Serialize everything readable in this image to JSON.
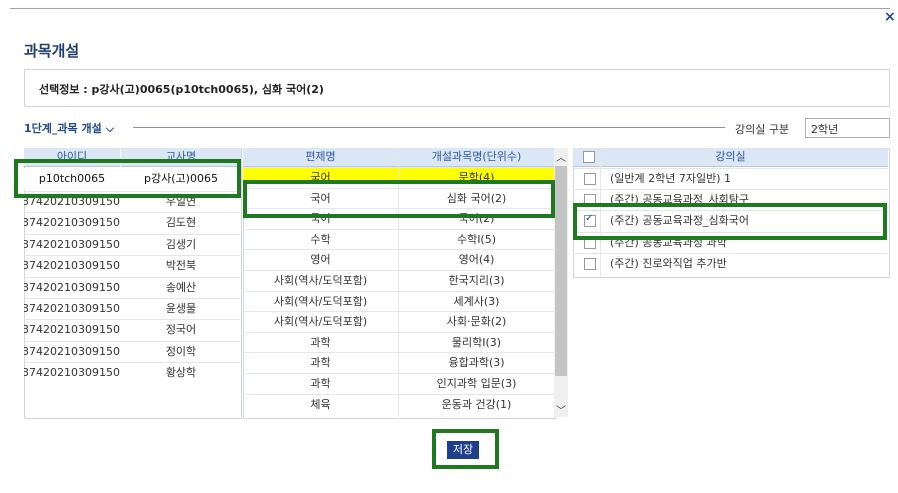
{
  "dialog": {
    "title": "과목개설",
    "close_label": "×",
    "selection_info": "선택정보 : p강사(고)0065(p10tch0065), 심화 국어(2)",
    "step_label": "1단계_과목 개설",
    "step_chevron": "chevron-down-icon",
    "room_type_label": "강의실 구분",
    "room_type_value": "2학년",
    "save_label": "저장"
  },
  "teachers": {
    "headers": [
      "아이디",
      "교사명"
    ],
    "selected": {
      "id": "p10tch0065",
      "name": "p강사(고)0065"
    },
    "rows": [
      {
        "id": "37420210309150",
        "name": "우일연"
      },
      {
        "id": "37420210309150",
        "name": "김도현"
      },
      {
        "id": "37420210309150",
        "name": "김생기"
      },
      {
        "id": "37420210309150",
        "name": "박전북"
      },
      {
        "id": "37420210309150",
        "name": "송예산"
      },
      {
        "id": "37420210309150",
        "name": "윤생물"
      },
      {
        "id": "37420210309150",
        "name": "정국어"
      },
      {
        "id": "37420210309150",
        "name": "정이학"
      },
      {
        "id": "37420210309150",
        "name": "황상학"
      }
    ]
  },
  "subjects": {
    "headers": [
      "편제명",
      "개설과목명(단위수)"
    ],
    "rows": [
      {
        "group": "국어",
        "name": "문학(4)",
        "highlight": true
      },
      {
        "group": "국어",
        "name": "심화 국어(2)",
        "selected": true
      },
      {
        "group": "국어",
        "name": "국어(2)"
      },
      {
        "group": "수학",
        "name": "수학Ⅰ(5)"
      },
      {
        "group": "영어",
        "name": "영어(4)"
      },
      {
        "group": "사회(역사/도덕포함)",
        "name": "한국지리(3)"
      },
      {
        "group": "사회(역사/도덕포함)",
        "name": "세계사(3)"
      },
      {
        "group": "사회(역사/도덕포함)",
        "name": "사회·문화(2)"
      },
      {
        "group": "과학",
        "name": "물리학Ⅰ(3)"
      },
      {
        "group": "과학",
        "name": "융합과학(3)"
      },
      {
        "group": "과학",
        "name": "인지과학 입문(3)"
      },
      {
        "group": "체육",
        "name": "운동과 건강(1)"
      }
    ]
  },
  "rooms": {
    "header": "강의실",
    "rows": [
      {
        "label": "(일반계 2학년 7자일반) 1",
        "checked": false
      },
      {
        "label": "(주간) 공동교육과정_사회탐구",
        "checked": false
      },
      {
        "label": "(주간) 공동교육과정_심화국어",
        "checked": true
      },
      {
        "label": "(주간) 공동교육과정 과학",
        "checked": false
      },
      {
        "label": "(주간) 진로와직업 추가반",
        "checked": false
      }
    ]
  }
}
